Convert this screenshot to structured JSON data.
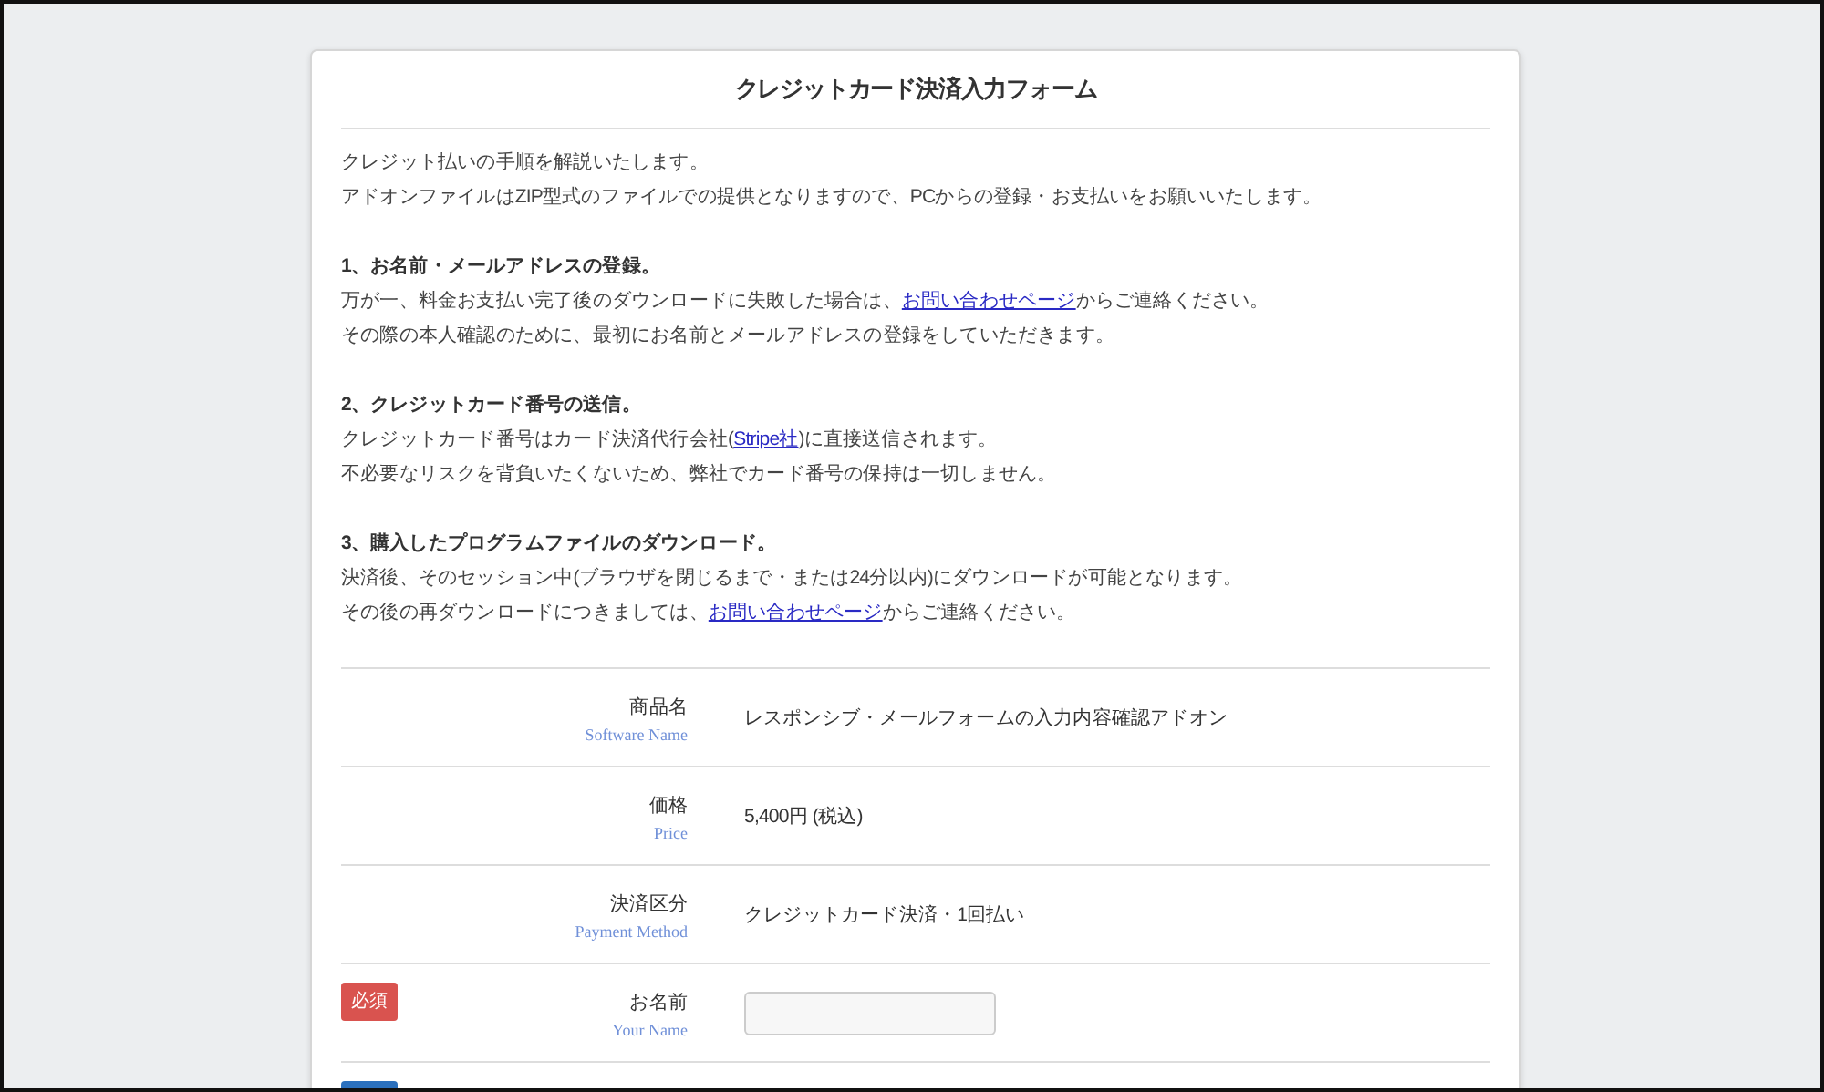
{
  "form": {
    "title": "クレジットカード決済入力フォーム",
    "intro": [
      [
        {
          "kind": "text",
          "text": "クレジット払いの手順を解説いたします。"
        }
      ],
      [
        {
          "kind": "text",
          "text": "アドオンファイルはZIP型式のファイルでの提供となりますので、PCからの登録・お支払いをお願いいたします。"
        }
      ]
    ],
    "steps": [
      {
        "heading": "1、お名前・メールアドレスの登録。",
        "lines": [
          [
            {
              "kind": "text",
              "text": "万が一、料金お支払い完了後のダウンロードに失敗した場合は、"
            },
            {
              "kind": "link",
              "text": "お問い合わせページ"
            },
            {
              "kind": "text",
              "text": "からご連絡ください。"
            }
          ],
          [
            {
              "kind": "text",
              "text": "その際の本人確認のために、最初にお名前とメールアドレスの登録をしていただきます。"
            }
          ]
        ]
      },
      {
        "heading": "2、クレジットカード番号の送信。",
        "lines": [
          [
            {
              "kind": "text",
              "text": "クレジットカード番号はカード決済代行会社("
            },
            {
              "kind": "link",
              "text": "Stripe社"
            },
            {
              "kind": "text",
              "text": ")に直接送信されます。"
            }
          ],
          [
            {
              "kind": "text",
              "text": "不必要なリスクを背負いたくないため、弊社でカード番号の保持は一切しません。"
            }
          ]
        ]
      },
      {
        "heading": "3、購入したプログラムファイルのダウンロード。",
        "lines": [
          [
            {
              "kind": "text",
              "text": "決済後、そのセッション中(ブラウザを閉じるまで・または24分以内)にダウンロードが可能となります。"
            }
          ],
          [
            {
              "kind": "text",
              "text": "その後の再ダウンロードにつきましては、"
            },
            {
              "kind": "link",
              "text": "お問い合わせページ"
            },
            {
              "kind": "text",
              "text": "からご連絡ください。"
            }
          ]
        ]
      }
    ],
    "rows": [
      {
        "kind": "text",
        "label": "商品名",
        "sublabel": "Software Name",
        "value": "レスポンシブ・メールフォームの入力内容確認アドオン"
      },
      {
        "kind": "text",
        "label": "価格",
        "sublabel": "Price",
        "value": "5,400円 (税込)"
      },
      {
        "kind": "text",
        "label": "決済区分",
        "sublabel": "Payment Method",
        "value": "クレジットカード決済・1回払い"
      },
      {
        "kind": "input",
        "badge": {
          "text": "必須",
          "color": "#d9534f"
        },
        "label": "お名前",
        "sublabel": "Your Name"
      },
      {
        "kind": "cut",
        "badge": {
          "color": "#2b70bd"
        }
      }
    ]
  }
}
